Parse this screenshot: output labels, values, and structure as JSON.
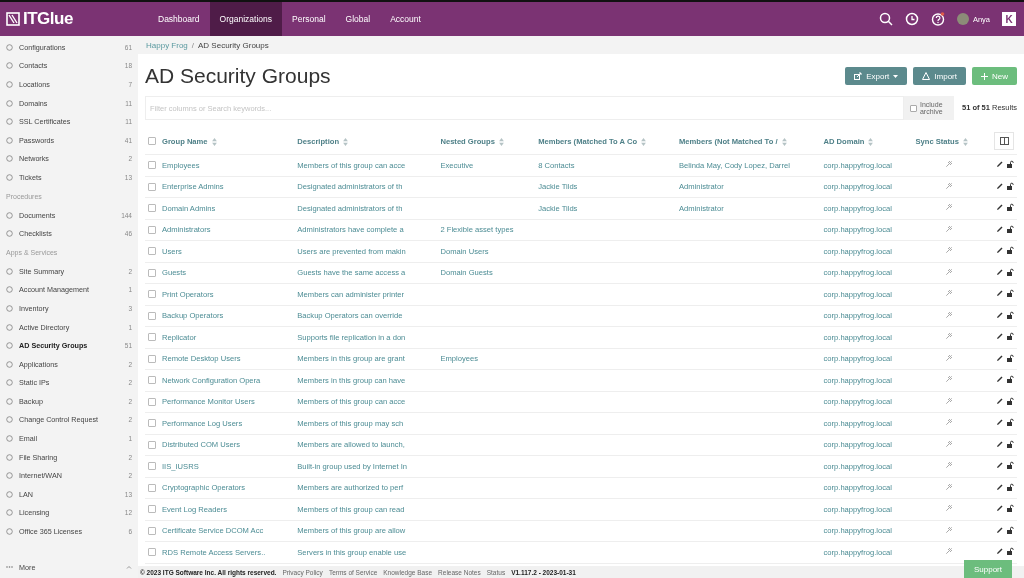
{
  "topbar": {
    "logo": "ITGlue",
    "nav": [
      {
        "label": "Dashboard",
        "selected": false
      },
      {
        "label": "Organizations",
        "selected": true
      },
      {
        "label": "Personal",
        "selected": false
      },
      {
        "label": "Global",
        "selected": false
      },
      {
        "label": "Account",
        "selected": false
      }
    ],
    "user": "Anya",
    "switcher": "K"
  },
  "sidebar": {
    "sections": [
      {
        "items": [
          {
            "label": "Configurations",
            "count": "61",
            "selected": false
          },
          {
            "label": "Contacts",
            "count": "18",
            "selected": false
          },
          {
            "label": "Locations",
            "count": "7",
            "selected": false
          },
          {
            "label": "Domains",
            "count": "11",
            "selected": false
          },
          {
            "label": "SSL Certificates",
            "count": "11",
            "selected": false
          },
          {
            "label": "Passwords",
            "count": "41",
            "selected": false
          },
          {
            "label": "Networks",
            "count": "2",
            "selected": false
          },
          {
            "label": "Tickets",
            "count": "13",
            "selected": false
          }
        ]
      },
      {
        "title": "Procedures",
        "items": [
          {
            "label": "Documents",
            "count": "144",
            "selected": false
          },
          {
            "label": "Checklists",
            "count": "46",
            "selected": false
          }
        ]
      },
      {
        "title": "Apps & Services",
        "items": [
          {
            "label": "Site Summary",
            "count": "2",
            "selected": false
          },
          {
            "label": "Account Management",
            "count": "1",
            "selected": false
          },
          {
            "label": "Inventory",
            "count": "3",
            "selected": false
          },
          {
            "label": "Active Directory",
            "count": "1",
            "selected": false
          },
          {
            "label": "AD Security Groups",
            "count": "51",
            "selected": true
          },
          {
            "label": "Applications",
            "count": "2",
            "selected": false
          },
          {
            "label": "Static IPs",
            "count": "2",
            "selected": false
          },
          {
            "label": "Backup",
            "count": "2",
            "selected": false
          },
          {
            "label": "Change Control Request",
            "count": "2",
            "selected": false
          },
          {
            "label": "Email",
            "count": "1",
            "selected": false
          },
          {
            "label": "File Sharing",
            "count": "2",
            "selected": false
          },
          {
            "label": "Internet/WAN",
            "count": "2",
            "selected": false
          },
          {
            "label": "LAN",
            "count": "13",
            "selected": false
          },
          {
            "label": "Licensing",
            "count": "12",
            "selected": false
          },
          {
            "label": "Office 365 Licenses",
            "count": "6",
            "selected": false
          }
        ]
      }
    ],
    "more": "More"
  },
  "breadcrumb": [
    "Happy Frog",
    "/",
    "AD Security Groups"
  ],
  "title": "AD Security Groups",
  "actions": [
    {
      "label": "Export",
      "kind": "export"
    },
    {
      "label": "Import",
      "kind": "import"
    },
    {
      "label": "New",
      "kind": "new"
    }
  ],
  "search": {
    "placeholder": "Filter columns or Search keywords...",
    "include_archive": {
      "label": "Include archive",
      "checked": false
    },
    "results": "**51 of 51** Results"
  },
  "table": {
    "select_all_checked": false,
    "columns": [
      "Group Name",
      "Description",
      "Nested Groups",
      "Members (Matched To A Co",
      "Members (Not Matched To /",
      "AD Domain",
      "Sync Status"
    ],
    "rows": [
      {
        "checked": false,
        "cells": [
          "Employees",
          "Members of this group can acce",
          "Executive",
          "8 Contacts",
          "Belinda May, Cody Lopez, Darrel",
          "corp.happyfrog.local"
        ]
      },
      {
        "checked": false,
        "cells": [
          "Enterprise Admins",
          "Designated administrators of th",
          "",
          "Jackie Tilds",
          "Administrator",
          "corp.happyfrog.local"
        ]
      },
      {
        "checked": false,
        "cells": [
          "Domain Admins",
          "Designated administrators of th",
          "",
          "Jackie Tilds",
          "Administrator",
          "corp.happyfrog.local"
        ]
      },
      {
        "checked": false,
        "cells": [
          "Administrators",
          "Administrators have complete a",
          "2 Flexible asset types",
          "",
          "",
          "corp.happyfrog.local"
        ]
      },
      {
        "checked": false,
        "cells": [
          "Users",
          "Users are prevented from makin",
          "Domain Users",
          "",
          "",
          "corp.happyfrog.local"
        ]
      },
      {
        "checked": false,
        "cells": [
          "Guests",
          "Guests have the same access a",
          "Domain Guests",
          "",
          "",
          "corp.happyfrog.local"
        ]
      },
      {
        "checked": false,
        "cells": [
          "Print Operators",
          "Members can administer printer",
          "",
          "",
          "",
          "corp.happyfrog.local"
        ]
      },
      {
        "checked": false,
        "cells": [
          "Backup Operators",
          "Backup Operators can override",
          "",
          "",
          "",
          "corp.happyfrog.local"
        ]
      },
      {
        "checked": false,
        "cells": [
          "Replicator",
          "Supports file replication in a don",
          "",
          "",
          "",
          "corp.happyfrog.local"
        ]
      },
      {
        "checked": false,
        "cells": [
          "Remote Desktop Users",
          "Members in this group are grant",
          "Employees",
          "",
          "",
          "corp.happyfrog.local"
        ]
      },
      {
        "checked": false,
        "cells": [
          "Network Configuration Opera",
          "Members in this group can have",
          "",
          "",
          "",
          "corp.happyfrog.local"
        ]
      },
      {
        "checked": false,
        "cells": [
          "Performance Monitor Users",
          "Members of this group can acce",
          "",
          "",
          "",
          "corp.happyfrog.local"
        ]
      },
      {
        "checked": false,
        "cells": [
          "Performance Log Users",
          "Members of this group may sch",
          "",
          "",
          "",
          "corp.happyfrog.local"
        ]
      },
      {
        "checked": false,
        "cells": [
          "Distributed COM Users",
          "Members are allowed to launch,",
          "",
          "",
          "",
          "corp.happyfrog.local"
        ]
      },
      {
        "checked": false,
        "cells": [
          "IIS_IUSRS",
          "Built-in group used by Internet In",
          "",
          "",
          "",
          "corp.happyfrog.local"
        ]
      },
      {
        "checked": false,
        "cells": [
          "Cryptographic Operators",
          "Members are authorized to perf",
          "",
          "",
          "",
          "corp.happyfrog.local"
        ]
      },
      {
        "checked": false,
        "cells": [
          "Event Log Readers",
          "Members of this group can read",
          "",
          "",
          "",
          "corp.happyfrog.local"
        ]
      },
      {
        "checked": false,
        "cells": [
          "Certificate Service DCOM Acc",
          "Members of this group are allow",
          "",
          "",
          "",
          "corp.happyfrog.local"
        ]
      },
      {
        "checked": false,
        "cells": [
          "RDS Remote Access Servers..",
          "Servers in this group enable use",
          "",
          "",
          "",
          "corp.happyfrog.local"
        ]
      }
    ]
  },
  "footer": {
    "copyright": "© 2023 ITG Software Inc. All rights reserved.",
    "links": [
      "Privacy Policy",
      "Terms of Service",
      "Knowledge Base",
      "Release Notes",
      "Status"
    ],
    "version": "V1.117.2 - 2023-01-31"
  },
  "support": "Support"
}
